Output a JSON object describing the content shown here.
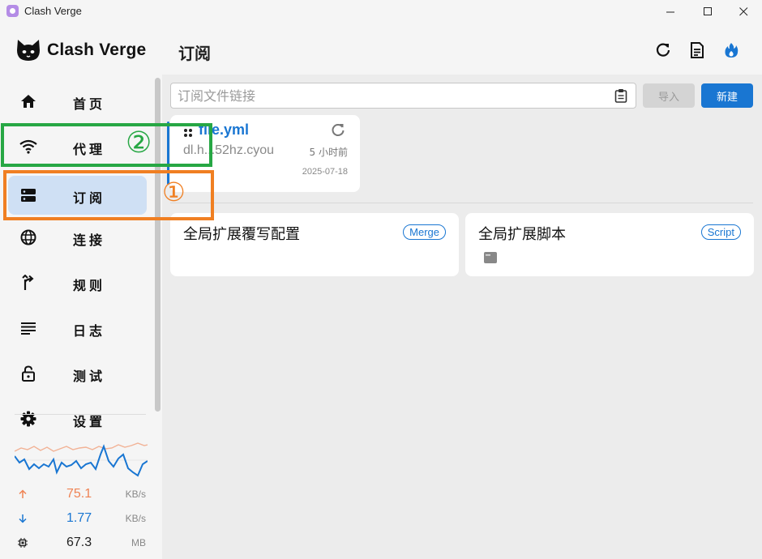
{
  "window": {
    "title": "Clash Verge"
  },
  "sidebar": {
    "logo_text": "Clash Verge",
    "items": [
      {
        "label": "首页",
        "icon": "home-icon"
      },
      {
        "label": "代理",
        "icon": "wifi-icon"
      },
      {
        "label": "订阅",
        "icon": "storage-icon",
        "active": true
      },
      {
        "label": "连接",
        "icon": "globe-icon"
      },
      {
        "label": "规则",
        "icon": "fork-icon"
      },
      {
        "label": "日志",
        "icon": "list-icon"
      },
      {
        "label": "测试",
        "icon": "lock-icon"
      },
      {
        "label": "设置",
        "icon": "gear-icon"
      }
    ],
    "stats": {
      "upload": {
        "value": "75.1",
        "unit": "KB/s",
        "color": "#ef8354"
      },
      "download": {
        "value": "1.77",
        "unit": "KB/s",
        "color": "#1976d2"
      },
      "memory": {
        "value": "67.3",
        "unit": "MB"
      }
    }
  },
  "header": {
    "title": "订阅"
  },
  "toolbar": {
    "url_placeholder": "订阅文件链接",
    "url_value": "",
    "import_label": "导入",
    "new_label": "新建"
  },
  "profile": {
    "name": "file.yml",
    "host": "dl.h...52hz.cyou",
    "updated_ago": "5 小时前",
    "date": "2025-07-18"
  },
  "extensions": [
    {
      "title": "全局扩展覆写配置",
      "badge": "Merge"
    },
    {
      "title": "全局扩展脚本",
      "badge": "Script"
    }
  ],
  "annotations": {
    "green": "②",
    "orange": "①"
  },
  "colors": {
    "accent": "#1976d2",
    "active_bg": "#cfe0f4",
    "green": "#27a744",
    "orange": "#f07f22"
  }
}
